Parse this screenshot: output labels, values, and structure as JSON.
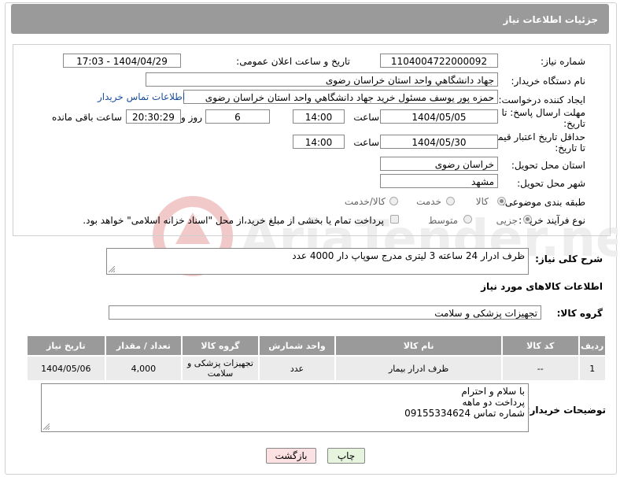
{
  "header": {
    "title": "جزئیات اطلاعات نیاز"
  },
  "form": {
    "need_number_label": "شماره نیاز:",
    "need_number": "1104004722000092",
    "announce_label": "تاریخ و ساعت اعلان عمومی:",
    "announce_value": "1404/04/29 - 17:03",
    "buyer_org_label": "نام دستگاه خریدار:",
    "buyer_org": "جهاد دانشگاهي واحد استان خراسان رضوی",
    "creator_label": "ایجاد کننده درخواست:",
    "creator": "حمزه  پور یوسف مسئول خرید جهاد دانشگاهي واحد استان خراسان رضوی",
    "contact_link": "اطلاعات تماس خریدار",
    "deadline_label_1": "مهلت ارسال پاسخ: تا",
    "deadline_label_2": "تاریخ:",
    "deadline_date": "1404/05/05",
    "time_label": "ساعت",
    "deadline_time": "14:00",
    "days_value": "6",
    "days_label": "روز و",
    "remaining_time": "20:30:29",
    "remaining_label": "ساعت باقی مانده",
    "price_label_1": "حداقل تاریخ اعتبار قیمت:",
    "price_label_2": "تا تاریخ:",
    "price_date": "1404/05/30",
    "price_time": "14:00",
    "province_label": "استان محل تحویل:",
    "province": "خراسان رضوی",
    "city_label": "شهر محل تحویل:",
    "city": "مشهد",
    "category_label": "طبقه بندی موضوعی:",
    "category_options": [
      "کالا",
      "خدمت",
      "کالا/خدمت"
    ],
    "process_label": "نوع فرآیند خرید :",
    "process_options": [
      "جزیی",
      "متوسط"
    ],
    "payment_note": "پرداخت تمام یا بخشی از مبلغ خرید،از محل \"اسناد خزانه اسلامی\" خواهد بود."
  },
  "description": {
    "label": "شرح کلی نیاز:",
    "text": "ظرف ادرار 24 ساعته 3 لیتری مدرج سوپاپ دار 4000 عدد"
  },
  "goods": {
    "section_title": "اطلاعات کالاهای مورد نیاز",
    "group_label": "گروه کالا:",
    "group_value": "تجهیزات پزشکی و سلامت",
    "columns": [
      "ردیف",
      "کد کالا",
      "نام کالا",
      "واحد شمارش",
      "گروه کالا",
      "تعداد / مقدار",
      "تاریخ نیاز"
    ],
    "rows": [
      {
        "row": "1",
        "code": "--",
        "name": "ظرف ادرار بیمار",
        "unit": "عدد",
        "group": "تجهیزات پزشکی و سلامت",
        "qty": "4,000",
        "date": "1404/05/06"
      }
    ]
  },
  "buyer_notes": {
    "label": "توضیحات خریدار:",
    "line1": "با سلام و احترام",
    "line2": "پرداخت دو ماهه",
    "line3": "شماره تماس 09155334624"
  },
  "buttons": {
    "print": "چاپ",
    "back": "بازگشت"
  },
  "watermark": {
    "text": "AriaTender.neT"
  }
}
